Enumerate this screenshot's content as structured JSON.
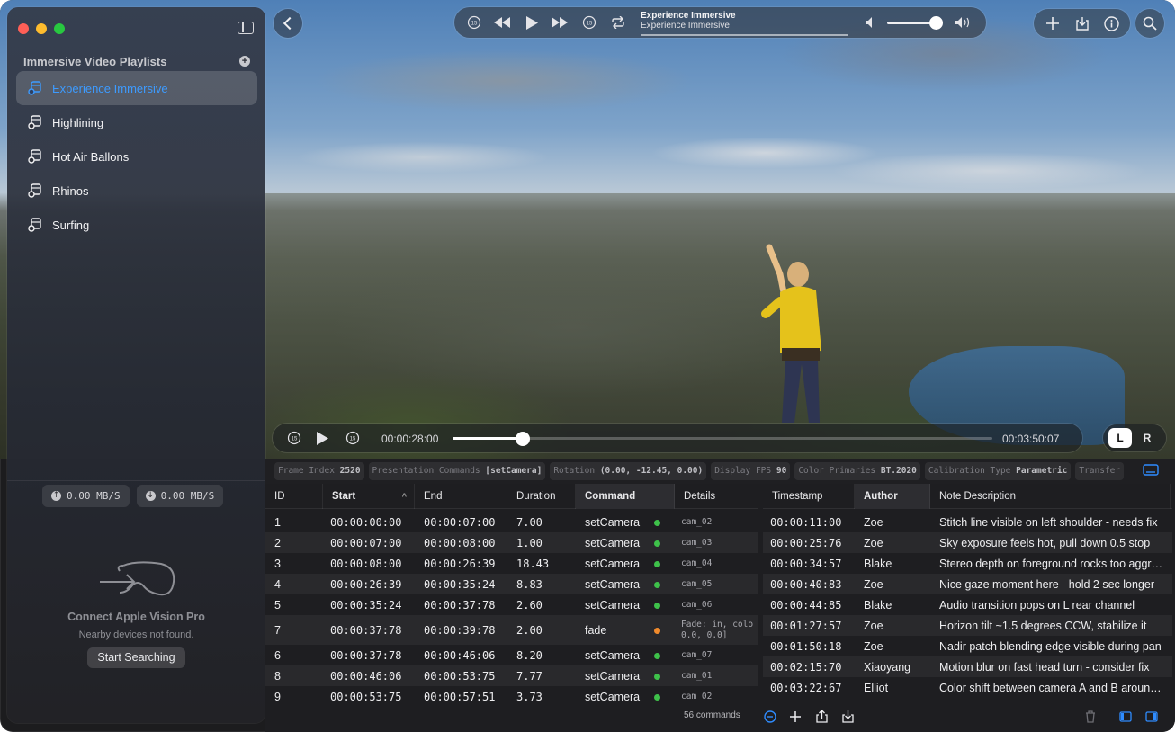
{
  "window": {
    "controls": [
      "close",
      "minimize",
      "zoom"
    ]
  },
  "sidebar": {
    "section_title": "Immersive Video Playlists",
    "add_icon": "plus-circle-icon",
    "toggle_icon": "sidebar-icon",
    "items": [
      {
        "label": "Experience Immersive",
        "active": true,
        "icon": "playlist-icon"
      },
      {
        "label": "Highlining",
        "active": false,
        "icon": "playlist-icon"
      },
      {
        "label": "Hot Air Ballons",
        "active": false,
        "icon": "playlist-icon"
      },
      {
        "label": "Rhinos",
        "active": false,
        "icon": "playlist-icon"
      },
      {
        "label": "Surfing",
        "active": false,
        "icon": "playlist-icon"
      }
    ],
    "upload_speed": "0.00 MB/S",
    "download_speed": "0.00 MB/S",
    "connect_title": "Connect Apple Vision Pro",
    "connect_subtitle": "Nearby devices not found.",
    "connect_button": "Start Searching"
  },
  "player": {
    "title": "Experience Immersive",
    "subtitle": "Experience Immersive",
    "skip_back_seconds": "15",
    "skip_forward_seconds": "15",
    "volume_level": 0.8,
    "current_time": "00:00:28:00",
    "total_time": "00:03:50:07",
    "progress": 0.13,
    "eye_left": "L",
    "eye_right": "R",
    "accent": "#3d9bff"
  },
  "metadata": [
    {
      "label": "Frame Index",
      "value": "2520"
    },
    {
      "label": "Presentation Commands",
      "value": "[setCamera]"
    },
    {
      "label": "Rotation",
      "value": "(0.00, -12.45, 0.00)"
    },
    {
      "label": "Display FPS",
      "value": "90"
    },
    {
      "label": "Color Primaries",
      "value": "BT.2020"
    },
    {
      "label": "Calibration Type",
      "value": "Parametric"
    },
    {
      "label": "Transfer",
      "value": ""
    }
  ],
  "commands_table": {
    "headers": {
      "id": "ID",
      "start": "Start",
      "end": "End",
      "duration": "Duration",
      "command": "Command",
      "details": "Details"
    },
    "rows": [
      {
        "id": "1",
        "start": "00:00:00:00",
        "end": "00:00:07:00",
        "duration": "7.00",
        "command": "setCamera",
        "status": "#3ec14a",
        "details": "cam_02"
      },
      {
        "id": "2",
        "start": "00:00:07:00",
        "end": "00:00:08:00",
        "duration": "1.00",
        "command": "setCamera",
        "status": "#3ec14a",
        "details": "cam_03"
      },
      {
        "id": "3",
        "start": "00:00:08:00",
        "end": "00:00:26:39",
        "duration": "18.43",
        "command": "setCamera",
        "status": "#3ec14a",
        "details": "cam_04"
      },
      {
        "id": "4",
        "start": "00:00:26:39",
        "end": "00:00:35:24",
        "duration": "8.83",
        "command": "setCamera",
        "status": "#3ec14a",
        "details": "cam_05"
      },
      {
        "id": "5",
        "start": "00:00:35:24",
        "end": "00:00:37:78",
        "duration": "2.60",
        "command": "setCamera",
        "status": "#3ec14a",
        "details": "cam_06"
      },
      {
        "id": "7",
        "start": "00:00:37:78",
        "end": "00:00:39:78",
        "duration": "2.00",
        "command": "fade",
        "status": "#f08a2c",
        "details": "Fade: in, colo",
        "details2": "0.0, 0.0]"
      },
      {
        "id": "6",
        "start": "00:00:37:78",
        "end": "00:00:46:06",
        "duration": "8.20",
        "command": "setCamera",
        "status": "#3ec14a",
        "details": "cam_07"
      },
      {
        "id": "8",
        "start": "00:00:46:06",
        "end": "00:00:53:75",
        "duration": "7.77",
        "command": "setCamera",
        "status": "#3ec14a",
        "details": "cam_01"
      },
      {
        "id": "9",
        "start": "00:00:53:75",
        "end": "00:00:57:51",
        "duration": "3.73",
        "command": "setCamera",
        "status": "#3ec14a",
        "details": "cam_02"
      }
    ],
    "count_label": "56 commands"
  },
  "notes_table": {
    "headers": {
      "timestamp": "Timestamp",
      "author": "Author",
      "note": "Note Description"
    },
    "rows": [
      {
        "timestamp": "00:00:11:00",
        "author": "Zoe",
        "note": "Stitch line visible on left shoulder - needs fix"
      },
      {
        "timestamp": "00:00:25:76",
        "author": "Zoe",
        "note": "Sky exposure feels hot, pull down 0.5 stop"
      },
      {
        "timestamp": "00:00:34:57",
        "author": "Blake",
        "note": "Stereo depth on foreground rocks too aggressive"
      },
      {
        "timestamp": "00:00:40:83",
        "author": "Zoe",
        "note": "Nice gaze moment here - hold 2 sec longer"
      },
      {
        "timestamp": "00:00:44:85",
        "author": "Blake",
        "note": "Audio transition pops on L rear channel"
      },
      {
        "timestamp": "00:01:27:57",
        "author": "Zoe",
        "note": "Horizon tilt ~1.5 degrees CCW, stabilize it"
      },
      {
        "timestamp": "00:01:50:18",
        "author": "Zoe",
        "note": "Nadir patch blending edge visible during pan"
      },
      {
        "timestamp": "00:02:15:70",
        "author": "Xiaoyang",
        "note": "Motion blur on fast head turn - consider fix"
      },
      {
        "timestamp": "00:03:22:67",
        "author": "Elliot",
        "note": "Color shift between camera A and B around cut"
      }
    ]
  }
}
